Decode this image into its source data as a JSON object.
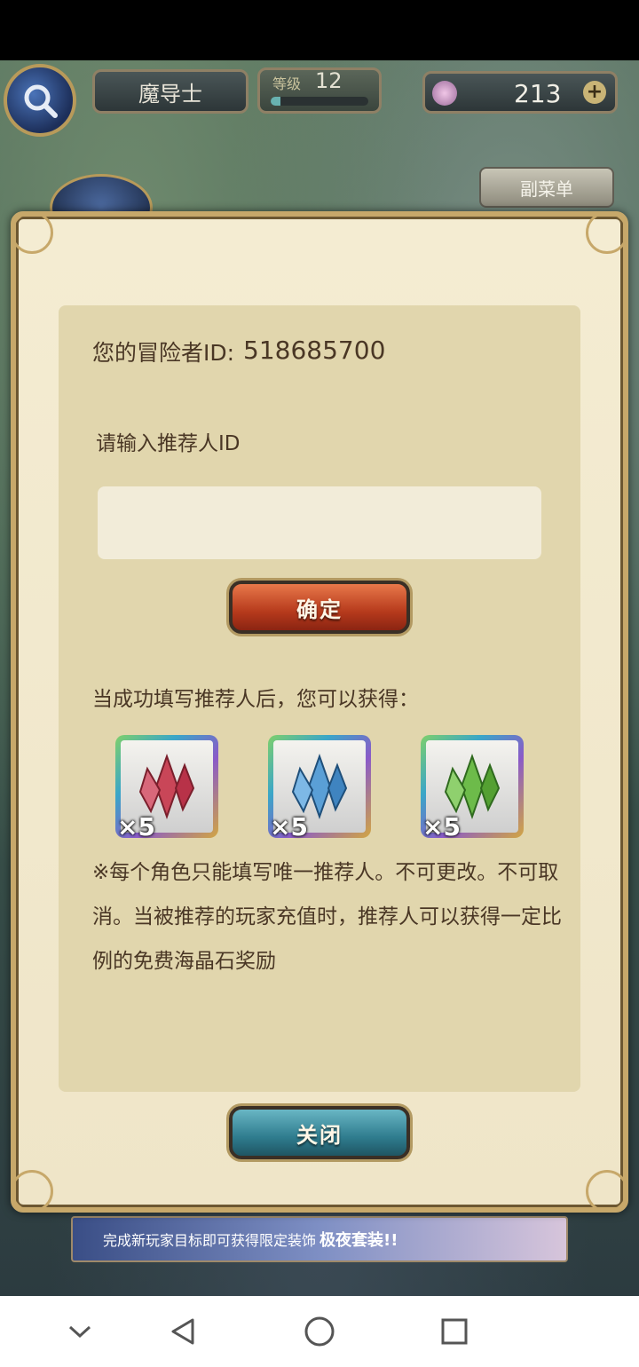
{
  "hud": {
    "character_name": "魔导士",
    "level_label": "等级",
    "level_value": "12",
    "level_progress": 0.1,
    "gem_count": "213"
  },
  "submenu_label": "副菜单",
  "dialog": {
    "adventurer_id_label": "您的冒险者ID:",
    "adventurer_id_value": "518685700",
    "referrer_label": "请输入推荐人ID",
    "referrer_input_value": "",
    "confirm_label": "确定",
    "reward_note": "当成功填写推荐人后，您可以获得：",
    "rewards": [
      {
        "icon": "red-crystal-icon",
        "color": "#c94658",
        "qty": "×5"
      },
      {
        "icon": "blue-crystal-icon",
        "color": "#5a9fd6",
        "qty": "×5"
      },
      {
        "icon": "green-crystal-icon",
        "color": "#6dbb4a",
        "qty": "×5"
      }
    ],
    "notice": "※每个角色只能填写唯一推荐人。不可更改。不可取消。当被推荐的玩家充值时，推荐人可以获得一定比例的免费海晶石奖励",
    "close_label": "关闭"
  },
  "banner": {
    "text": "完成新玩家目标即可获得限定装饰",
    "highlight": "极夜套装!!"
  },
  "navbar": {
    "icons": [
      "chevron-down-icon",
      "back-icon",
      "home-icon",
      "recents-icon"
    ]
  }
}
